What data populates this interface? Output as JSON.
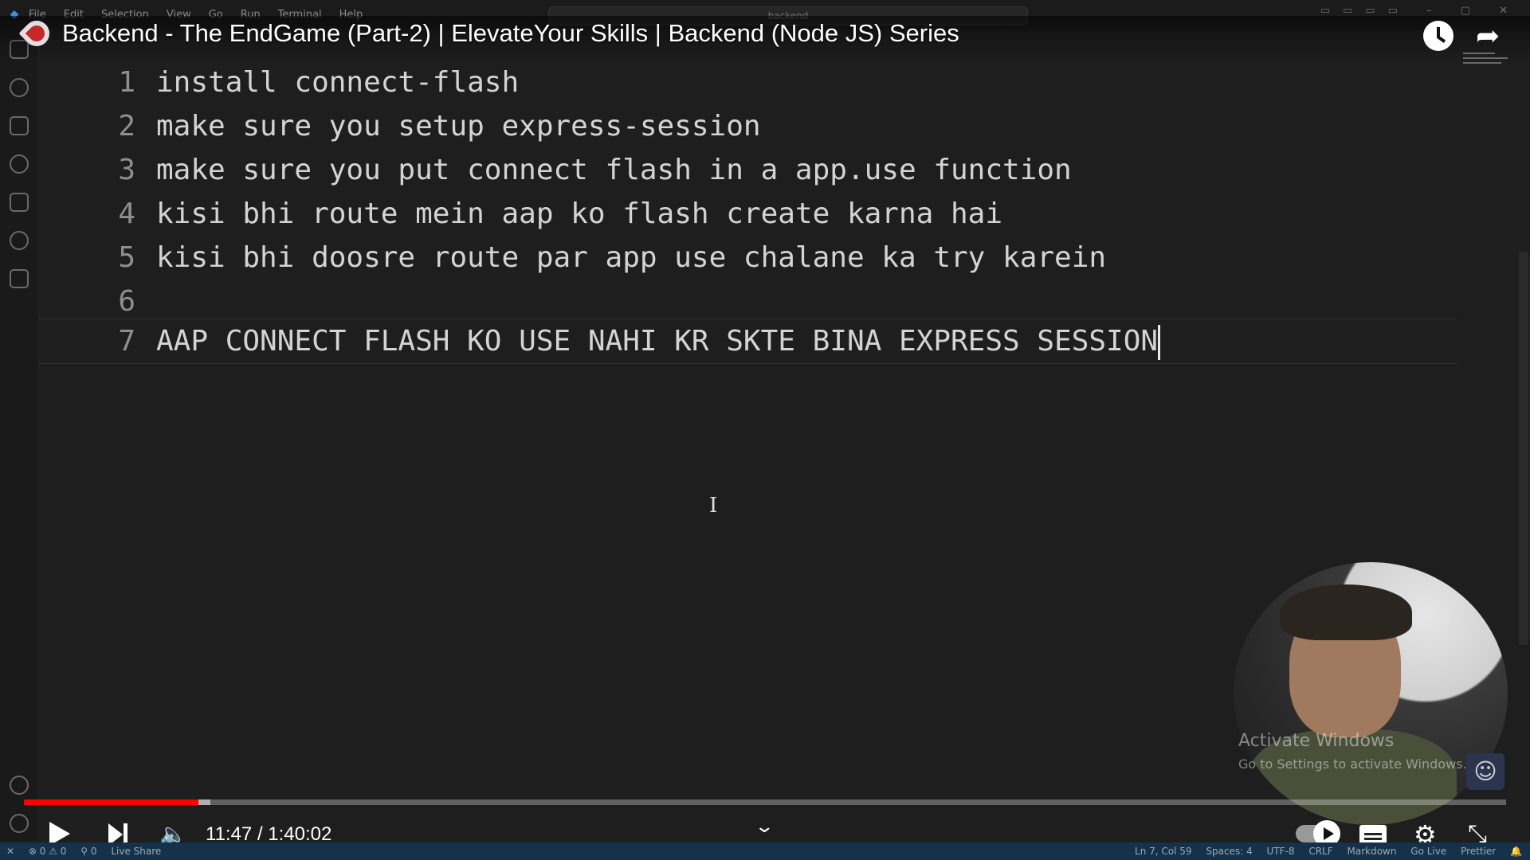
{
  "menubar": {
    "items": [
      "File",
      "Edit",
      "Selection",
      "View",
      "Go",
      "Run",
      "Terminal",
      "Help"
    ],
    "search_text": "backend"
  },
  "video": {
    "title": "Backend - The EndGame (Part-2) | ElevateYour Skills | Backend (Node JS) Series",
    "time_current": "11:47",
    "time_total": "1:40:02",
    "time_display": "11:47 / 1:40:02",
    "progress_fraction": 0.118,
    "buffer_end_fraction": 0.126
  },
  "editor": {
    "lines": [
      {
        "number": "1",
        "text": "install connect-flash"
      },
      {
        "number": "2",
        "text": "make sure you setup express-session"
      },
      {
        "number": "3",
        "text": "make sure you put connect flash in a app.use function"
      },
      {
        "number": "4",
        "text": "kisi bhi route mein aap ko flash create karna hai"
      },
      {
        "number": "5",
        "text": "kisi bhi doosre route par app use chalane ka try karein"
      },
      {
        "number": "6",
        "text": ""
      },
      {
        "number": "7",
        "text": "AAP CONNECT FLASH KO USE NAHI KR SKTE BINA EXPRESS SESSION"
      }
    ]
  },
  "watermark": {
    "title": "Activate Windows",
    "subtitle": "Go to Settings to activate Windows."
  },
  "statusbar": {
    "errors": "0",
    "warnings": "0",
    "ports": "0",
    "live_share": "Live Share",
    "position": "Ln 7, Col 59",
    "spaces": "Spaces: 4",
    "encoding": "UTF-8",
    "eol": "CRLF",
    "language": "Markdown",
    "go_live": "Go Live",
    "prettier": "Prettier"
  },
  "colors": {
    "progress_played": "#ff0000",
    "statusbar_bg": "#16324a",
    "editor_bg": "#1e1e1e"
  }
}
